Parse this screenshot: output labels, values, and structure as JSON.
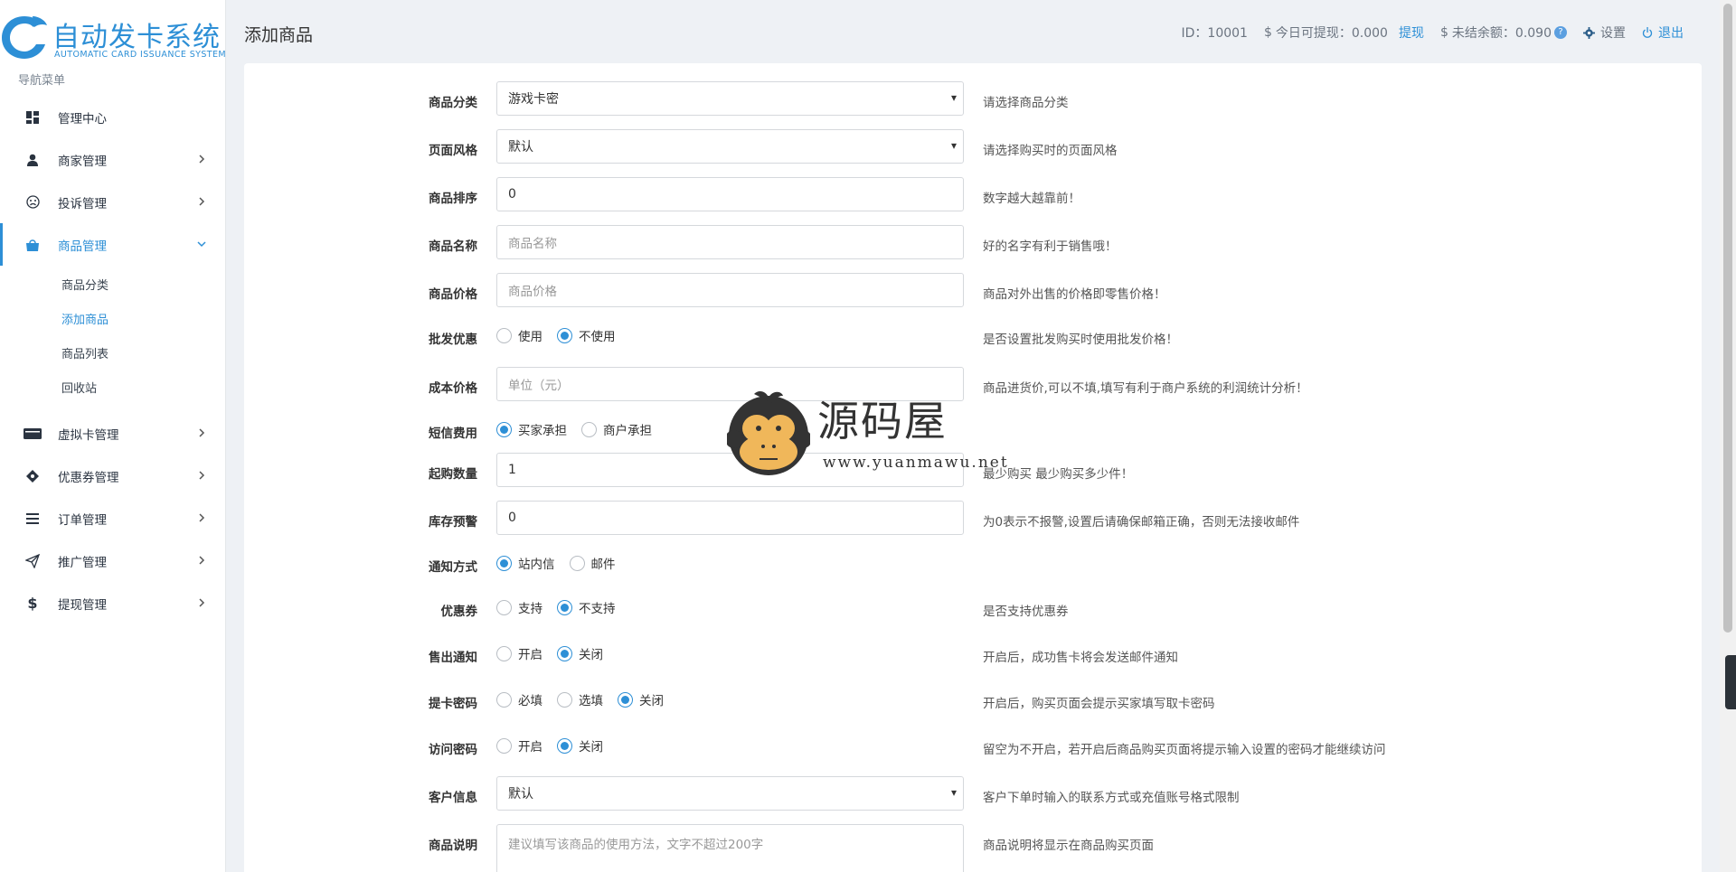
{
  "app": {
    "title": "自动发卡系统",
    "subtitle": "AUTOMATIC CARD ISSUANCE SYSTEM"
  },
  "sidebar": {
    "heading": "导航菜单",
    "items": [
      {
        "label": "管理中心",
        "icon": "dashboard-icon"
      },
      {
        "label": "商家管理",
        "icon": "user-icon"
      },
      {
        "label": "投诉管理",
        "icon": "frown-icon"
      },
      {
        "label": "商品管理",
        "icon": "shopping-bag-icon",
        "active": true
      },
      {
        "label": "虚拟卡管理",
        "icon": "card-icon"
      },
      {
        "label": "优惠券管理",
        "icon": "ticket-icon"
      },
      {
        "label": "订单管理",
        "icon": "list-icon"
      },
      {
        "label": "推广管理",
        "icon": "send-icon"
      },
      {
        "label": "提现管理",
        "icon": "dollar-icon"
      }
    ],
    "subitems": [
      "商品分类",
      "添加商品",
      "商品列表",
      "回收站"
    ]
  },
  "header": {
    "page_title": "添加商品",
    "id_text": "ID：10001",
    "today_withdraw_label": "今日可提现：0.000",
    "withdraw_link": "提现",
    "unsettled_label": "未结余额：0.090",
    "help_mark": "?",
    "settings_label": "设置",
    "logout_label": "退出"
  },
  "form": {
    "category": {
      "label": "商品分类",
      "value": "游戏卡密",
      "hint": "请选择商品分类"
    },
    "style": {
      "label": "页面风格",
      "value": "默认",
      "hint": "请选择购买时的页面风格"
    },
    "sort": {
      "label": "商品排序",
      "value": "0",
      "hint": "数字越大越靠前！"
    },
    "name": {
      "label": "商品名称",
      "placeholder": "商品名称",
      "hint": "好的名字有利于销售哦！"
    },
    "price": {
      "label": "商品价格",
      "placeholder": "商品价格",
      "hint": "商品对外出售的价格即零售价格！"
    },
    "wholesale": {
      "label": "批发优惠",
      "options": [
        "使用",
        "不使用"
      ],
      "selected": 1,
      "hint": "是否设置批发购买时使用批发价格！"
    },
    "cost": {
      "label": "成本价格",
      "placeholder": "单位（元）",
      "hint": "商品进货价,可以不填,填写有利于商户系统的利润统计分析！"
    },
    "sms": {
      "label": "短信费用",
      "options": [
        "买家承担",
        "商户承担"
      ],
      "selected": 0
    },
    "min_qty": {
      "label": "起购数量",
      "value": "1",
      "hint": "最少购买 最少购买多少件！"
    },
    "stock_alert": {
      "label": "库存预警",
      "value": "0",
      "hint": "为0表示不报警,设置后请确保邮箱正确，否则无法接收邮件"
    },
    "notify": {
      "label": "通知方式",
      "options": [
        "站内信",
        "邮件"
      ],
      "selected": 0
    },
    "coupon": {
      "label": "优惠券",
      "options": [
        "支持",
        "不支持"
      ],
      "selected": 1,
      "hint": "是否支持优惠券"
    },
    "sold_notify": {
      "label": "售出通知",
      "options": [
        "开启",
        "关闭"
      ],
      "selected": 1,
      "hint": "开启后，成功售卡将会发送邮件通知"
    },
    "card_pwd": {
      "label": "提卡密码",
      "options": [
        "必填",
        "选填",
        "关闭"
      ],
      "selected": 2,
      "hint": "开启后，购买页面会提示买家填写取卡密码"
    },
    "visit_pwd": {
      "label": "访问密码",
      "options": [
        "开启",
        "关闭"
      ],
      "selected": 1,
      "hint": "留空为不开启，若开启后商品购买页面将提示输入设置的密码才能继续访问"
    },
    "customer_info": {
      "label": "客户信息",
      "value": "默认",
      "hint": "客户下单时输入的联系方式或充值账号格式限制"
    },
    "description": {
      "label": "商品说明",
      "placeholder": "建议填写该商品的使用方法，文字不超过200字",
      "hint": "商品说明将显示在商品购买页面"
    }
  },
  "watermark": {
    "text": "源码屋",
    "url": "www.yuanmawu.net"
  },
  "colors": {
    "accent": "#2d8fd6",
    "background": "#eef1f5",
    "panel": "#ffffff"
  }
}
